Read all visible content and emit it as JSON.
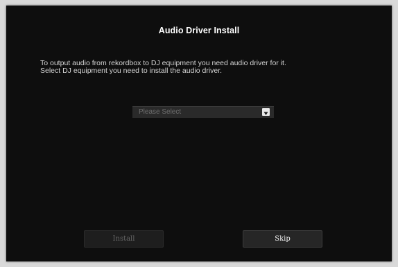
{
  "dialog": {
    "title": "Audio Driver Install",
    "description_line1": "To output audio from rekordbox to DJ equipment you need audio driver for it.",
    "description_line2": "Select DJ equipment you need to install the audio driver.",
    "equipment_select": {
      "value": "Please Select",
      "arrow_icon": "triangle-down-icon"
    },
    "install_label": "Install",
    "skip_label": "Skip"
  },
  "colors": {
    "window_background": "#0e0e0e",
    "outer_background": "#d9d9d9",
    "select_background": "#2a2a2a",
    "disabled_text": "#666666"
  }
}
